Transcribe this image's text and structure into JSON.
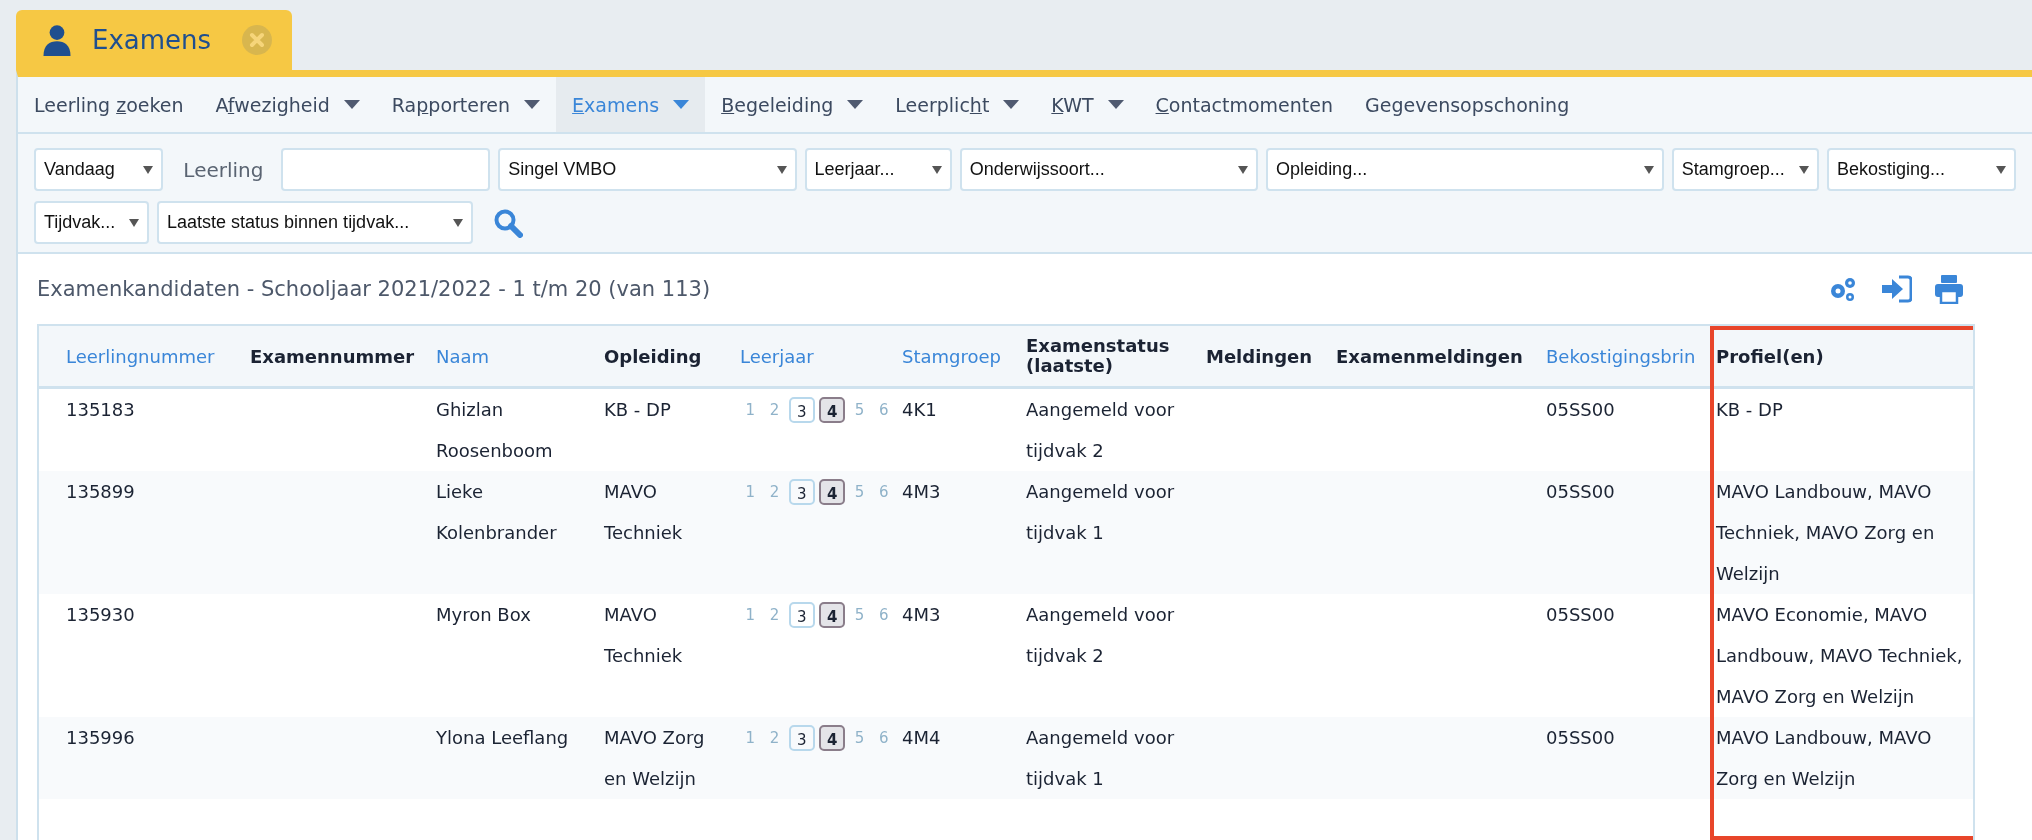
{
  "tab": {
    "title": "Examens"
  },
  "menu": [
    {
      "before": "Leerling ",
      "key": "z",
      "after": "oeken",
      "dropdown": false,
      "selected": false
    },
    {
      "before": "A",
      "key": "f",
      "after": "wezigheid",
      "dropdown": true,
      "selected": false
    },
    {
      "before": "Ra",
      "key": "p",
      "after": "porteren",
      "dropdown": true,
      "selected": false
    },
    {
      "key": "E",
      "after": "xamens",
      "dropdown": true,
      "selected": true
    },
    {
      "key": "B",
      "after": "egeleiding",
      "dropdown": true,
      "selected": false
    },
    {
      "before": "Leerplic",
      "key": "h",
      "after": "t",
      "dropdown": true,
      "selected": false
    },
    {
      "key": "K",
      "after": "WT",
      "dropdown": true,
      "selected": false
    },
    {
      "key": "C",
      "after": "ontactmomenten",
      "dropdown": false,
      "selected": false
    },
    {
      "before": "Gegevensopschoning",
      "dropdown": false,
      "selected": false
    }
  ],
  "filters": [
    [
      {
        "kind": "select",
        "value": "Vandaag"
      },
      {
        "kind": "label",
        "value": "Leerling"
      },
      {
        "kind": "input"
      },
      {
        "kind": "select",
        "value": "Singel VMBO"
      },
      {
        "kind": "select",
        "value": "Leerjaar..."
      },
      {
        "kind": "select",
        "value": "Onderwijssoort..."
      },
      {
        "kind": "select",
        "value": "Opleiding..."
      },
      {
        "kind": "select",
        "value": "Stamgroep..."
      },
      {
        "kind": "select",
        "value": "Bekostiging..."
      }
    ],
    [
      {
        "kind": "select",
        "value": "Tijdvak..."
      },
      {
        "kind": "select",
        "value": "Laatste status binnen tijdvak..."
      },
      {
        "kind": "search"
      }
    ]
  ],
  "list_title": "Examenkandidaten - Schooljaar 2021/2022 - 1 t/m 20 (van 113)",
  "table": {
    "columns": [
      {
        "label": "Leerlingnummer",
        "sortable": true,
        "highlighted": false
      },
      {
        "label": "Examennummer",
        "sortable": false,
        "highlighted": false
      },
      {
        "label": "Naam",
        "sortable": true,
        "highlighted": false
      },
      {
        "label": "Opleiding",
        "sortable": false,
        "highlighted": false
      },
      {
        "label": "Leerjaar",
        "sortable": true,
        "highlighted": false
      },
      {
        "label": "Stamgroep",
        "sortable": true,
        "highlighted": false
      },
      {
        "label": "Examenstatus (laatste)",
        "sortable": false,
        "highlighted": false
      },
      {
        "label": "Meldingen",
        "sortable": false,
        "highlighted": false
      },
      {
        "label": "Examenmeldingen",
        "sortable": false,
        "highlighted": false
      },
      {
        "label": "Bekostigingsbrin",
        "sortable": true,
        "highlighted": false
      },
      {
        "label": "Profiel(en)",
        "sortable": false,
        "highlighted": true
      }
    ],
    "rows": [
      {
        "leerlingnummer": "135183",
        "naam": "Ghizlan Roosenboom",
        "opleiding": "KB - DP",
        "leerjaar": [
          {
            "label": "1",
            "kind": "plain"
          },
          {
            "label": "2",
            "kind": "plain"
          },
          {
            "label": "3",
            "kind": "outlined"
          },
          {
            "label": "4",
            "kind": "current"
          },
          {
            "label": "5",
            "kind": "plain"
          },
          {
            "label": "6",
            "kind": "plain"
          }
        ],
        "stamgroep": "4K1",
        "examenstatus": "Aangemeld voor tijdvak 2",
        "bekostigingsbrin": "05SS00",
        "profielen": "KB - DP"
      },
      {
        "leerlingnummer": "135899",
        "naam": "Lieke Kolenbrander",
        "opleiding": "MAVO Techniek",
        "leerjaar": [
          {
            "label": "1",
            "kind": "plain"
          },
          {
            "label": "2",
            "kind": "plain"
          },
          {
            "label": "3",
            "kind": "outlined"
          },
          {
            "label": "4",
            "kind": "current"
          },
          {
            "label": "5",
            "kind": "plain"
          },
          {
            "label": "6",
            "kind": "plain"
          }
        ],
        "stamgroep": "4M3",
        "examenstatus": "Aangemeld voor tijdvak 1",
        "bekostigingsbrin": "05SS00",
        "profielen": "MAVO Landbouw, MAVO Techniek, MAVO Zorg en Welzijn"
      },
      {
        "leerlingnummer": "135930",
        "naam": "Myron Box",
        "opleiding": "MAVO Techniek",
        "leerjaar": [
          {
            "label": "1",
            "kind": "plain"
          },
          {
            "label": "2",
            "kind": "plain"
          },
          {
            "label": "3",
            "kind": "outlined"
          },
          {
            "label": "4",
            "kind": "current"
          },
          {
            "label": "5",
            "kind": "plain"
          },
          {
            "label": "6",
            "kind": "plain"
          }
        ],
        "stamgroep": "4M3",
        "examenstatus": "Aangemeld voor tijdvak 2",
        "bekostigingsbrin": "05SS00",
        "profielen": "MAVO Economie, MAVO Landbouw, MAVO Techniek, MAVO Zorg en Welzijn"
      },
      {
        "leerlingnummer": "135996",
        "naam": "Ylona Leeflang",
        "opleiding": "MAVO Zorg en Welzijn",
        "leerjaar": [
          {
            "label": "1",
            "kind": "plain"
          },
          {
            "label": "2",
            "kind": "plain"
          },
          {
            "label": "3",
            "kind": "outlined"
          },
          {
            "label": "4",
            "kind": "current"
          },
          {
            "label": "5",
            "kind": "plain"
          },
          {
            "label": "6",
            "kind": "plain"
          }
        ],
        "stamgroep": "4M4",
        "examenstatus": "Aangemeld voor tijdvak 1",
        "bekostigingsbrin": "05SS00",
        "profielen": "MAVO Landbouw, MAVO Zorg en Welzijn"
      }
    ]
  }
}
